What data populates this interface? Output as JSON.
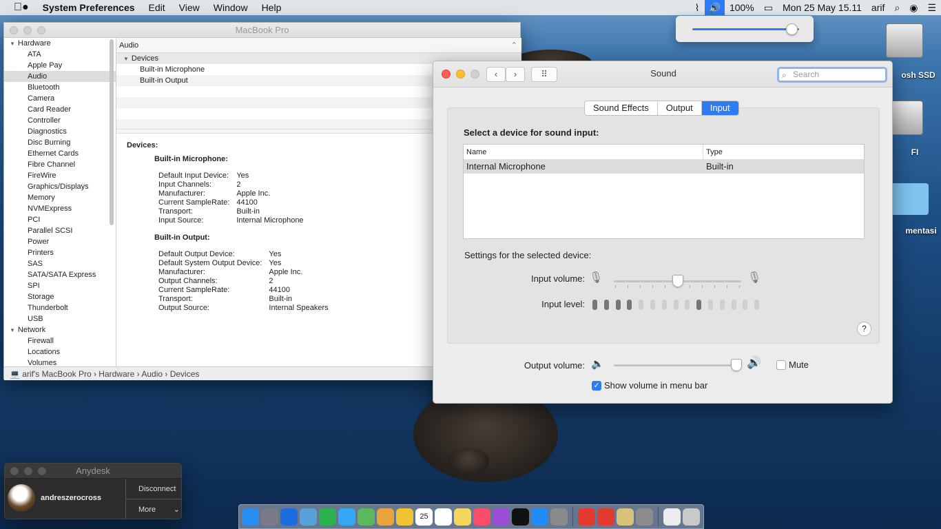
{
  "menubar": {
    "apple": "",
    "app_name": "System Preferences",
    "menus": [
      "Edit",
      "View",
      "Window",
      "Help"
    ],
    "battery": "100%",
    "datetime": "Mon 25 May  15.11",
    "user": "arif"
  },
  "volume_popup": {
    "level": 0.93
  },
  "desktop": {
    "icons": [
      {
        "label": "osh SSD"
      },
      {
        "label": "FI"
      },
      {
        "label": "mentasi"
      }
    ]
  },
  "sysinfo": {
    "title": "MacBook Pro",
    "sidebar": [
      {
        "label": "Hardware",
        "group": true
      },
      {
        "label": "ATA"
      },
      {
        "label": "Apple Pay"
      },
      {
        "label": "Audio",
        "selected": true
      },
      {
        "label": "Bluetooth"
      },
      {
        "label": "Camera"
      },
      {
        "label": "Card Reader"
      },
      {
        "label": "Controller"
      },
      {
        "label": "Diagnostics"
      },
      {
        "label": "Disc Burning"
      },
      {
        "label": "Ethernet Cards"
      },
      {
        "label": "Fibre Channel"
      },
      {
        "label": "FireWire"
      },
      {
        "label": "Graphics/Displays"
      },
      {
        "label": "Memory"
      },
      {
        "label": "NVMExpress"
      },
      {
        "label": "PCI"
      },
      {
        "label": "Parallel SCSI"
      },
      {
        "label": "Power"
      },
      {
        "label": "Printers"
      },
      {
        "label": "SAS"
      },
      {
        "label": "SATA/SATA Express"
      },
      {
        "label": "SPI"
      },
      {
        "label": "Storage"
      },
      {
        "label": "Thunderbolt"
      },
      {
        "label": "USB"
      },
      {
        "label": "Network",
        "group": true
      },
      {
        "label": "Firewall"
      },
      {
        "label": "Locations"
      },
      {
        "label": "Volumes"
      }
    ],
    "header": "Audio",
    "tree": [
      {
        "label": "Devices",
        "group": true
      },
      {
        "label": "Built-in Microphone"
      },
      {
        "label": "Built-in Output"
      }
    ],
    "detail": {
      "heading": "Devices:",
      "mic_title": "Built-in Microphone:",
      "mic": [
        [
          "Default Input Device:",
          "Yes"
        ],
        [
          "Input Channels:",
          "2"
        ],
        [
          "Manufacturer:",
          "Apple Inc."
        ],
        [
          "Current SampleRate:",
          "44100"
        ],
        [
          "Transport:",
          "Built-in"
        ],
        [
          "Input Source:",
          "Internal Microphone"
        ]
      ],
      "out_title": "Built-in Output:",
      "out": [
        [
          "Default Output Device:",
          "Yes"
        ],
        [
          "Default System Output Device:",
          "Yes"
        ],
        [
          "Manufacturer:",
          "Apple Inc."
        ],
        [
          "Output Channels:",
          "2"
        ],
        [
          "Current SampleRate:",
          "44100"
        ],
        [
          "Transport:",
          "Built-in"
        ],
        [
          "Output Source:",
          "Internal Speakers"
        ]
      ]
    },
    "path": [
      "arif's MacBook Pro",
      "Hardware",
      "Audio",
      "Devices"
    ]
  },
  "sound": {
    "title": "Sound",
    "search_placeholder": "Search",
    "tabs": [
      {
        "label": "Sound Effects"
      },
      {
        "label": "Output"
      },
      {
        "label": "Input",
        "active": true
      }
    ],
    "select_label": "Select a device for sound input:",
    "table": {
      "col_name": "Name",
      "col_type": "Type",
      "rows": [
        {
          "name": "Internal Microphone",
          "type": "Built-in"
        }
      ]
    },
    "settings_label": "Settings for the selected device:",
    "input_volume_label": "Input volume:",
    "input_volume": 0.5,
    "input_level_label": "Input level:",
    "input_level_lit": [
      1,
      2,
      3,
      4,
      10
    ],
    "input_level_count": 15,
    "help": "?",
    "output_volume_label": "Output volume:",
    "output_volume": 0.96,
    "mute_label": "Mute",
    "mute": false,
    "show_volume_label": "Show volume in menu bar",
    "show_volume": true
  },
  "anydesk": {
    "title": "Anydesk",
    "user": "andreszerocross",
    "disconnect": "Disconnect",
    "more": "More"
  },
  "dock": {
    "calendar_day": "25",
    "apps": [
      "finder-icon",
      "launchpad-icon",
      "safari-icon",
      "preview-icon",
      "facetime-icon",
      "messages-icon",
      "maps-icon",
      "photos-icon",
      "notes-icon",
      "calendar-icon",
      "reminders-icon",
      "stickies-icon",
      "music-icon",
      "podcasts-icon",
      "tv-icon",
      "appstore-icon",
      "sysprefs-icon",
      "anydesk-icon",
      "anydesk-alt-icon",
      "archive-icon",
      "script-icon",
      "document-icon",
      "trash-icon"
    ]
  }
}
